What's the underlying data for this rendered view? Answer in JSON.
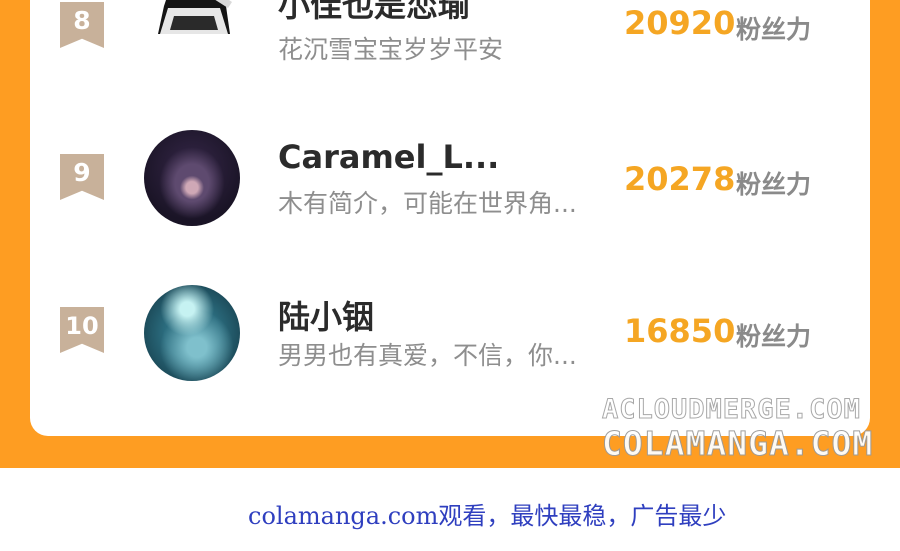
{
  "leaderboard": {
    "rows": [
      {
        "rank": "8",
        "name": "小佳也是恋瑜",
        "bio": "花沉雪宝宝岁岁平安",
        "score": "20920",
        "score_unit": "粉丝力"
      },
      {
        "rank": "9",
        "name": "Caramel_L...",
        "bio": "木有简介，可能在世界角...",
        "score": "20278",
        "score_unit": "粉丝力"
      },
      {
        "rank": "10",
        "name": "陆小铟",
        "bio": "男男也有真爱，不信，你...",
        "score": "16850",
        "score_unit": "粉丝力"
      }
    ]
  },
  "watermark": {
    "line1": "ACLOUDMERGE.COM",
    "line2": "COLAMANGA.COM"
  },
  "footer": {
    "text": "colamanga.com观看，最快最稳，广告最少"
  },
  "colors": {
    "frame_orange": "#fe9d22",
    "score_orange": "#f5a623",
    "badge_tan": "#c8b19a",
    "footer_blue": "#2f3fbf"
  }
}
